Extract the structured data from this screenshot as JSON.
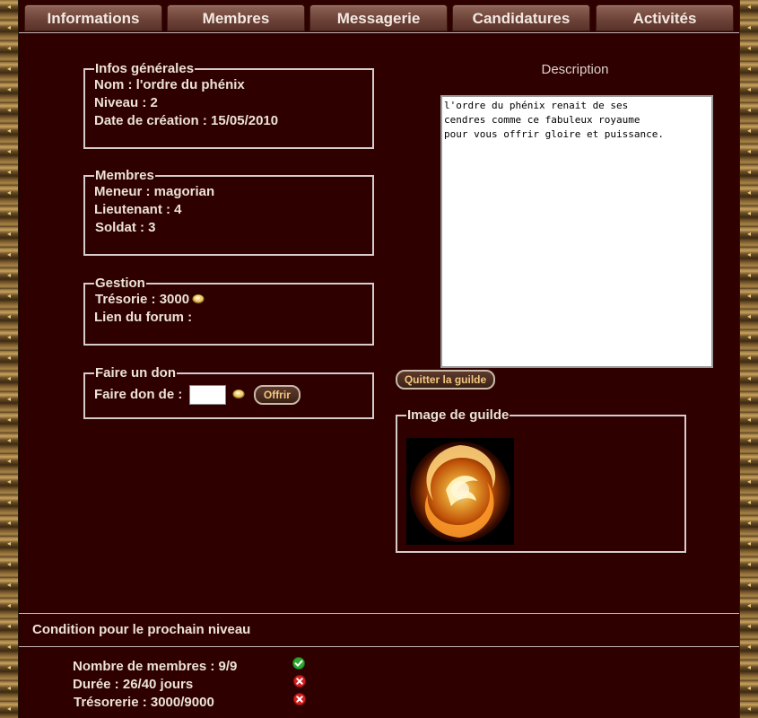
{
  "tabs": [
    "Informations",
    "Membres",
    "Messagerie",
    "Candidatures",
    "Activités"
  ],
  "infos": {
    "legend": "Infos générales",
    "nom": "Nom : l'ordre du phénix",
    "niveau": "Niveau : 2",
    "date": "Date de création : 15/05/2010"
  },
  "membres": {
    "legend": "Membres",
    "meneur": "Meneur : magorian",
    "lieutenant": "Lieutenant : 4",
    "soldat": "Soldat : 3"
  },
  "gestion": {
    "legend": "Gestion",
    "tresorie": "Trésorie : 3000",
    "forum": "Lien du forum :"
  },
  "don": {
    "legend": "Faire un don",
    "label": "Faire don de :",
    "input_value": "",
    "button": "Offrir"
  },
  "description": {
    "title": "Description",
    "text": "l'ordre du phénix renait de ses\ncendres comme ce fabuleux royaume\npour vous offrir gloire et puissance."
  },
  "quit_button": "Quitter la guilde",
  "image": {
    "legend": "Image de guilde"
  },
  "conditions": {
    "title": "Condition pour le prochain niveau",
    "rows": [
      {
        "text": "Nombre de membres : 9/9",
        "status": "ok"
      },
      {
        "text": "Durée : 26/40 jours",
        "status": "fail"
      },
      {
        "text": "Trésorerie : 3000/9000",
        "status": "fail"
      }
    ]
  },
  "colors": {
    "background": "#2e0000",
    "accent": "#f0c880",
    "ok": "#2fa82f",
    "fail": "#d62020"
  },
  "icons": {
    "coin": "gold-coin-icon",
    "ok": "check-icon",
    "fail": "cross-icon",
    "guild": "phoenix-emblem"
  }
}
